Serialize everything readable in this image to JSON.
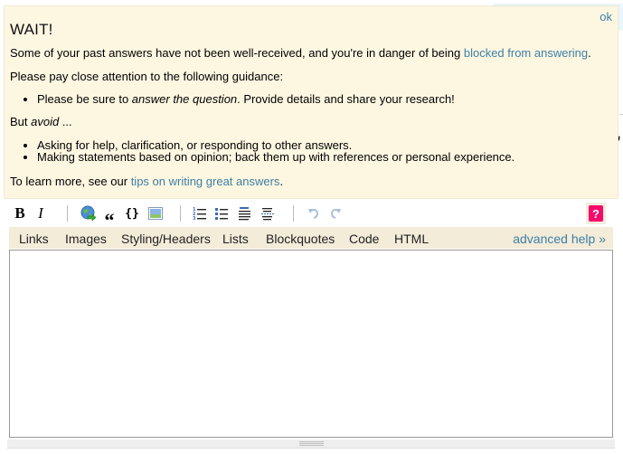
{
  "popup": {
    "dismiss_label": "ok",
    "title": "WAIT!",
    "intro_text": "Some of your past answers have not been well-received, and you're in danger of being ",
    "intro_link": "blocked from answering",
    "intro_end": ".",
    "guidance_text": "Please pay close attention to the following guidance:",
    "do_items": [
      {
        "prefix": "Please be sure to ",
        "emphasis": "answer the question",
        "suffix": ". Provide details and share your research!"
      }
    ],
    "avoid_prefix": "But ",
    "avoid_emphasis": "avoid",
    "avoid_suffix": " ...",
    "avoid_items": [
      "Asking for help, clarification, or responding to other answers.",
      "Making statements based on opinion; back them up with references or personal experience."
    ],
    "learn_prefix": "To learn more, see our ",
    "learn_link": "tips on writing great answers",
    "learn_end": "."
  },
  "toolbar": {
    "bold_label": "B",
    "italic_label": "I",
    "help_label": "?",
    "buttons": [
      {
        "name": "bold",
        "icon": "bold-icon"
      },
      {
        "name": "italic",
        "icon": "italic-icon"
      },
      {
        "name": "hyperlink",
        "icon": "globe-link-icon"
      },
      {
        "name": "blockquote",
        "icon": "quote-icon"
      },
      {
        "name": "code-sample",
        "icon": "code-braces-icon"
      },
      {
        "name": "image",
        "icon": "image-icon"
      },
      {
        "name": "numbered-list",
        "icon": "ordered-list-icon"
      },
      {
        "name": "bulleted-list",
        "icon": "unordered-list-icon"
      },
      {
        "name": "heading",
        "icon": "heading-icon"
      },
      {
        "name": "horizontal-rule",
        "icon": "horizontal-rule-icon"
      },
      {
        "name": "undo",
        "icon": "undo-icon"
      },
      {
        "name": "redo",
        "icon": "redo-icon"
      },
      {
        "name": "help",
        "icon": "question-icon"
      }
    ],
    "quote_glyph": "“",
    "braces_glyph": "{}"
  },
  "help_tabs": {
    "tabs": [
      "Links",
      "Images",
      "Styling/Headers",
      "Lists",
      "Blockquotes",
      "Code",
      "HTML"
    ],
    "advanced_label": "advanced help »"
  },
  "editor": {
    "value": "",
    "placeholder": ""
  },
  "colors": {
    "popup_bg": "#fdf7e2",
    "link": "#3d7fa6",
    "help_button": "#f50a6b",
    "help_bar_bg": "#f3ecd9"
  }
}
